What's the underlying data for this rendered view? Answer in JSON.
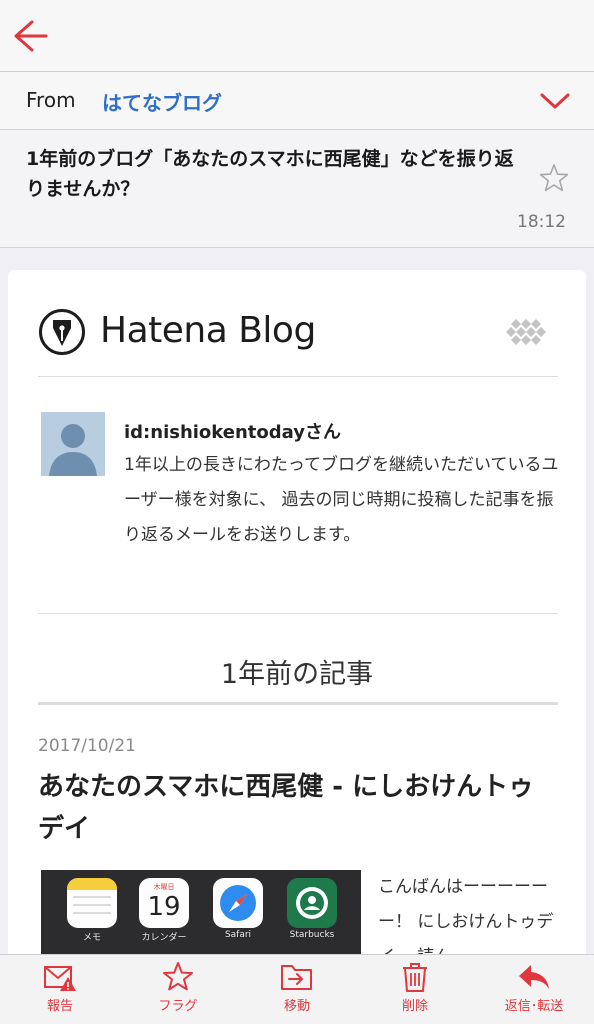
{
  "header": {
    "from_label": "From",
    "sender": "はてなブログ"
  },
  "message": {
    "subject": "1年前のブログ「あなたのスマホに西尾健」などを振り返りませんか？",
    "time": "18:12"
  },
  "mail": {
    "brand": "Hatena Blog",
    "username": "id:nishiokentodayさん",
    "intro": "1年以上の長きにわたってブログを継続いただいているユーザー様を対象に、 過去の同じ時期に投稿した記事を振り返るメールをお送りします。",
    "section_title": "1年前の記事",
    "article": {
      "date": "2017/10/21",
      "title": "あなたのスマホに西尾健 - にしおけんトゥデイ",
      "excerpt": "こんばんはーーーーーー！ にしおけんトゥデイ、 読ん",
      "thumb_apps": [
        "メモ",
        "カレンダー",
        "Safari",
        "Starbucks"
      ],
      "calendar_weekday": "木曜日",
      "calendar_day": "19"
    }
  },
  "toolbar": {
    "report": "報告",
    "flag": "フラグ",
    "move": "移動",
    "delete": "削除",
    "reply": "返信･転送"
  },
  "colors": {
    "accent": "#e0373e",
    "link": "#2f6fc4"
  }
}
